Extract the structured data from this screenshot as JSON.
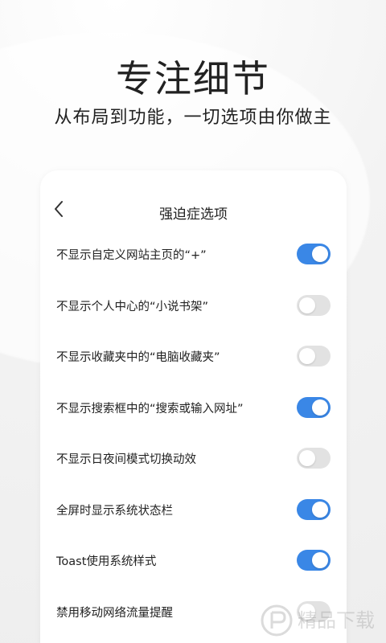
{
  "headline": "专注细节",
  "subheadline": "从布局到功能，一切选项由你做主",
  "card": {
    "back_icon": "chevron-left-icon",
    "title": "强迫症选项"
  },
  "settings": [
    {
      "label": "不显示自定义网站主页的“+”",
      "enabled": true
    },
    {
      "label": "不显示个人中心的“小说书架”",
      "enabled": false
    },
    {
      "label": "不显示收藏夹中的“电脑收藏夹”",
      "enabled": false
    },
    {
      "label": "不显示搜索框中的“搜索或输入网址”",
      "enabled": true
    },
    {
      "label": "不显示日夜间模式切换动效",
      "enabled": false
    },
    {
      "label": "全屏时显示系统状态栏",
      "enabled": true
    },
    {
      "label": "Toast使用系统样式",
      "enabled": true
    },
    {
      "label": "禁用移动网络流量提醒",
      "enabled": false
    }
  ],
  "colors": {
    "toggle_on": "#3a87e6",
    "toggle_off": "#e2e2e2"
  },
  "watermark": {
    "text": "精品下载"
  }
}
